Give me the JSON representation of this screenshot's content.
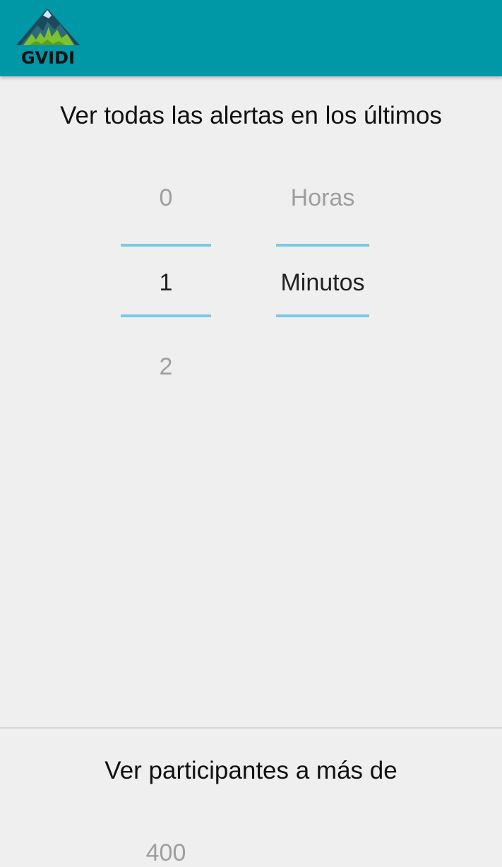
{
  "app_bar": {
    "logo_text": "GVIDI",
    "color": "#0097a7"
  },
  "alerts_section": {
    "title": "Ver todas las alertas en los últimos",
    "number_picker": {
      "prev": "0",
      "selected": "1",
      "next": "2"
    },
    "unit_picker": {
      "prev": "Horas",
      "selected": "Minutos"
    }
  },
  "participants_section": {
    "title": "Ver participantes a más de",
    "distance_picker": {
      "prev": "400"
    }
  },
  "colors": {
    "picker_divider": "#7ec8e6",
    "background": "#efefef"
  }
}
